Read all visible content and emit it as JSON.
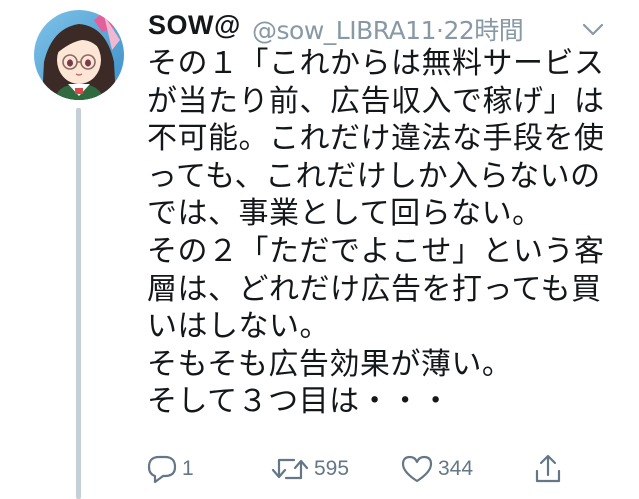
{
  "tweet": {
    "display_name": "SOW@",
    "handle": "@sow_LIBRA11",
    "separator": "·",
    "time": "22時間",
    "menu_icon": "chevron-down-icon",
    "avatar_icon": "user-avatar-anime-girl",
    "body_lines": [
      "その１「これからは無料サービス",
      "が当たり前、広告収入で稼げ」は",
      "不可能。これだけ違法な手段を使",
      "っても、これだけしか入らないの",
      "では、事業として回らない。",
      "その２「ただでよこせ」という客",
      "層は、どれだけ広告を打っても買",
      "いはしない。",
      "そもそも広告効果が薄い。",
      "そして３つ目は・・・"
    ],
    "actions": {
      "reply": {
        "icon": "reply-icon",
        "count": "1"
      },
      "retweet": {
        "icon": "retweet-icon",
        "count": "595"
      },
      "like": {
        "icon": "heart-icon",
        "count": "344"
      },
      "share": {
        "icon": "share-icon"
      }
    }
  },
  "colors": {
    "text": "#14171a",
    "secondary": "#8899a6",
    "icon": "#657786",
    "thread_line": "#c4cfd6"
  }
}
